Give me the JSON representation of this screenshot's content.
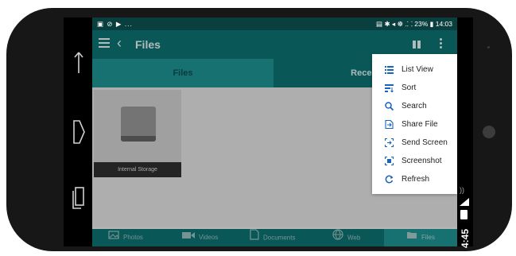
{
  "status_bar": {
    "left_icons": "▣ ⊘ ▶ ...",
    "right_text": "▤ ✱ ◂ ☸ .⸬ 23% ▮ 14:03"
  },
  "toolbar": {
    "back_glyph": "‹",
    "title": "Files"
  },
  "tabs": [
    {
      "label": "Files",
      "active": true
    },
    {
      "label": "Recent",
      "active": false
    }
  ],
  "storage": {
    "label": "Internal Storage",
    "icon": "hard-drive-icon"
  },
  "bottom_nav": [
    {
      "label": "Photos",
      "icon": "photos-icon"
    },
    {
      "label": "Videos",
      "icon": "videos-icon"
    },
    {
      "label": "Documents",
      "icon": "documents-icon"
    },
    {
      "label": "Web",
      "icon": "web-icon"
    },
    {
      "label": "Files",
      "icon": "files-icon",
      "active": true
    }
  ],
  "menu": [
    {
      "label": "List View",
      "icon": "list-view-icon"
    },
    {
      "label": "Sort",
      "icon": "sort-icon"
    },
    {
      "label": "Search",
      "icon": "search-icon"
    },
    {
      "label": "Share File",
      "icon": "share-file-icon"
    },
    {
      "label": "Send Screen",
      "icon": "send-screen-icon"
    },
    {
      "label": "Screenshot",
      "icon": "screenshot-icon"
    },
    {
      "label": "Refresh",
      "icon": "refresh-icon"
    }
  ],
  "device": {
    "side_time": "4:45"
  },
  "colors": {
    "toolbar": "#0d6b6b",
    "status_bar": "#0a3f3f",
    "active_tab": "#1d8a8a",
    "menu_icon": "#1565c0"
  }
}
